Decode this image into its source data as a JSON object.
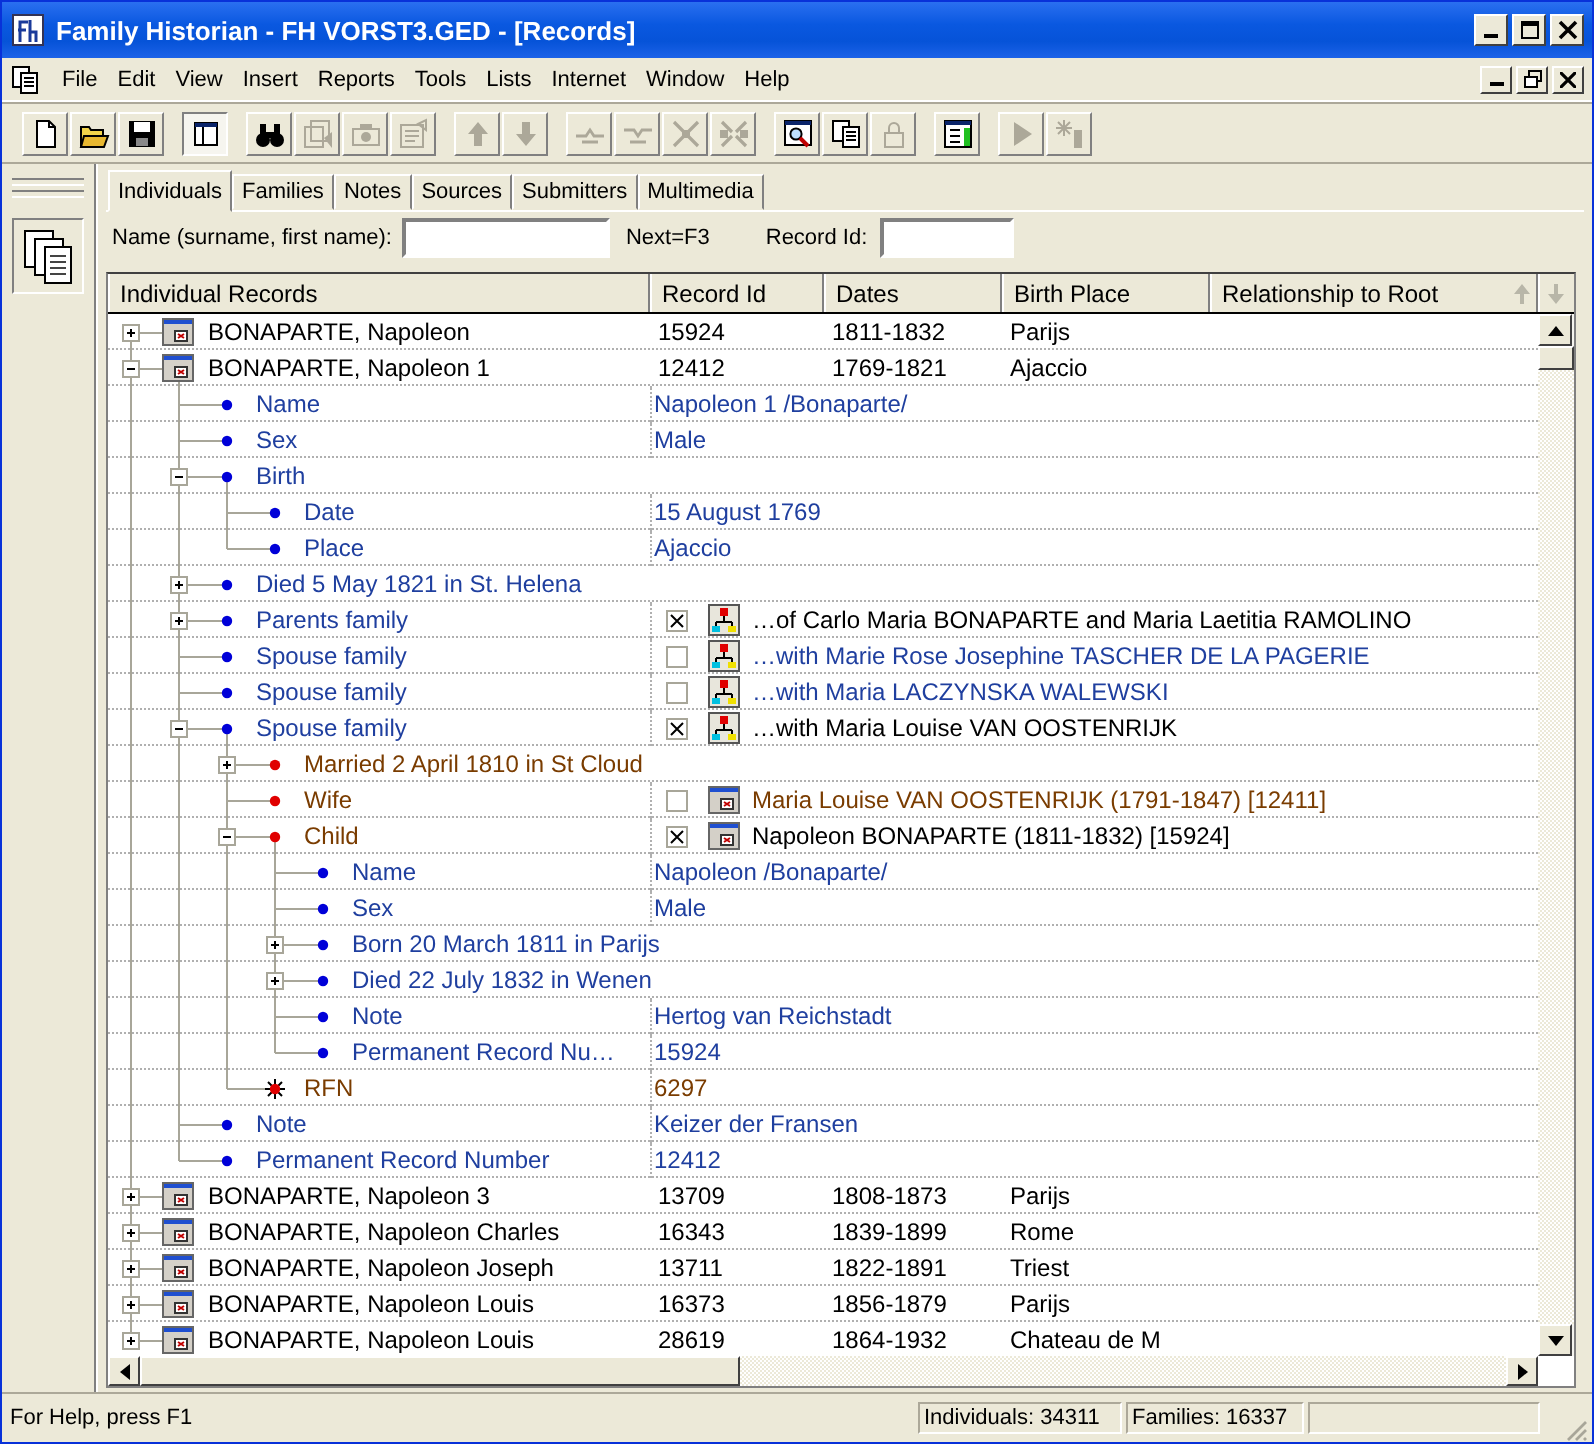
{
  "window": {
    "title": "Family Historian - FH VORST3.GED - [Records]"
  },
  "menu": [
    "File",
    "Edit",
    "View",
    "Insert",
    "Reports",
    "Tools",
    "Lists",
    "Internet",
    "Window",
    "Help"
  ],
  "toolbar": [
    [
      {
        "kind": "new",
        "disabled": false,
        "pressed": false
      },
      {
        "kind": "open",
        "disabled": false,
        "pressed": false
      },
      {
        "kind": "save",
        "disabled": false,
        "pressed": false
      }
    ],
    [
      {
        "kind": "layout",
        "disabled": false,
        "pressed": true
      }
    ],
    [
      {
        "kind": "find",
        "disabled": false,
        "pressed": false
      },
      {
        "kind": "records",
        "disabled": true,
        "pressed": false
      },
      {
        "kind": "camera",
        "disabled": true,
        "pressed": false
      },
      {
        "kind": "properties",
        "disabled": true,
        "pressed": false
      }
    ],
    [
      {
        "kind": "up",
        "disabled": true,
        "pressed": false
      },
      {
        "kind": "down",
        "disabled": true,
        "pressed": false
      }
    ],
    [
      {
        "kind": "branch_in",
        "disabled": true,
        "pressed": false
      },
      {
        "kind": "branch_out",
        "disabled": true,
        "pressed": false
      },
      {
        "kind": "expand_all",
        "disabled": true,
        "pressed": false
      },
      {
        "kind": "collapse_all",
        "disabled": true,
        "pressed": false
      }
    ],
    [
      {
        "kind": "preview",
        "disabled": false,
        "pressed": false
      },
      {
        "kind": "copy",
        "disabled": false,
        "pressed": false
      },
      {
        "kind": "lock",
        "disabled": true,
        "pressed": false
      }
    ],
    [
      {
        "kind": "app",
        "disabled": false,
        "pressed": false
      }
    ],
    [
      {
        "kind": "play",
        "disabled": true,
        "pressed": false
      },
      {
        "kind": "star",
        "disabled": true,
        "pressed": false
      }
    ]
  ],
  "tabs": [
    {
      "label": "Individuals",
      "selected": true
    },
    {
      "label": "Families",
      "selected": false
    },
    {
      "label": "Notes",
      "selected": false
    },
    {
      "label": "Sources",
      "selected": false
    },
    {
      "label": "Submitters",
      "selected": false
    },
    {
      "label": "Multimedia",
      "selected": false
    }
  ],
  "search": {
    "name_label": "Name (surname, first name):",
    "hint": "Next=F3",
    "id_label": "Record Id:"
  },
  "columns": [
    "Individual Records",
    "Record Id",
    "Dates",
    "Birth Place",
    "Relationship to Root"
  ],
  "records": [
    {
      "name": "BONAPARTE, Napoleon",
      "id": "15924",
      "dates": "1811-1832",
      "place": "Parijs",
      "expanded": false
    },
    {
      "name": "BONAPARTE, Napoleon 1",
      "id": "12412",
      "dates": "1769-1821",
      "place": "Ajaccio",
      "expanded": true,
      "children": [
        {
          "kind": "fact",
          "label": "Name",
          "value": "Napoleon 1 /Bonaparte/"
        },
        {
          "kind": "fact",
          "label": "Sex",
          "value": "Male"
        },
        {
          "kind": "fact",
          "label": "Birth",
          "expanded": true,
          "children": [
            {
              "kind": "fact",
              "label": "Date",
              "value": "15 August 1769"
            },
            {
              "kind": "fact",
              "label": "Place",
              "value": "Ajaccio"
            }
          ]
        },
        {
          "kind": "fact",
          "label": "Died 5 May 1821 in St. Helena",
          "expanded": false
        },
        {
          "kind": "fact",
          "label": "Parents family",
          "expanded": false,
          "link": {
            "kind": "family",
            "checked": true,
            "text": "…of Carlo Maria BONAPARTE and Maria Laetitia RAMOLINO"
          }
        },
        {
          "kind": "fact",
          "label": "Spouse family",
          "link": {
            "kind": "family",
            "checked": false,
            "text": "…with Marie Rose Josephine TASCHER DE LA PAGERIE"
          }
        },
        {
          "kind": "fact",
          "label": "Spouse family",
          "link": {
            "kind": "family",
            "checked": false,
            "text": "…with Maria LACZYNSKA WALEWSKI"
          }
        },
        {
          "kind": "fact",
          "label": "Spouse family",
          "expanded": true,
          "link": {
            "kind": "family",
            "checked": true,
            "text": "…with Maria Louise VAN OOSTENRIJK"
          },
          "children": [
            {
              "kind": "family_fact",
              "label": "Married 2 April 1810 in St Cloud",
              "expanded": false
            },
            {
              "kind": "family_fact",
              "label": "Wife",
              "link": {
                "kind": "record",
                "checked": false,
                "text": "Maria Louise VAN OOSTENRIJK (1791-1847) [12411]"
              }
            },
            {
              "kind": "family_fact",
              "label": "Child",
              "expanded": true,
              "link": {
                "kind": "record",
                "checked": true,
                "text": "Napoleon BONAPARTE (1811-1832) [15924]"
              },
              "children": [
                {
                  "kind": "fact",
                  "label": "Name",
                  "value": "Napoleon /Bonaparte/"
                },
                {
                  "kind": "fact",
                  "label": "Sex",
                  "value": "Male"
                },
                {
                  "kind": "fact",
                  "label": "Born 20 March 1811 in Parijs",
                  "expanded": false
                },
                {
                  "kind": "fact",
                  "label": "Died 22 July 1832 in Wenen",
                  "expanded": false
                },
                {
                  "kind": "fact",
                  "label": "Note",
                  "value": "Hertog van Reichstadt"
                },
                {
                  "kind": "fact",
                  "label": "Permanent Record Nu…",
                  "value": "15924"
                }
              ]
            },
            {
              "kind": "flag",
              "label": "RFN",
              "value": "6297"
            }
          ]
        },
        {
          "kind": "fact",
          "label": "Note",
          "value": "Keizer der Fransen"
        },
        {
          "kind": "fact",
          "label": "Permanent Record Number",
          "value": "12412"
        }
      ]
    },
    {
      "name": "BONAPARTE, Napoleon 3",
      "id": "13709",
      "dates": "1808-1873",
      "place": "Parijs",
      "expanded": false
    },
    {
      "name": "BONAPARTE, Napoleon Charles",
      "id": "16343",
      "dates": "1839-1899",
      "place": "Rome",
      "expanded": false
    },
    {
      "name": "BONAPARTE, Napoleon Joseph",
      "id": "13711",
      "dates": "1822-1891",
      "place": "Triest",
      "expanded": false
    },
    {
      "name": "BONAPARTE, Napoleon Louis",
      "id": "16373",
      "dates": "1856-1879",
      "place": "Parijs",
      "expanded": false
    },
    {
      "name": "BONAPARTE, Napoleon Louis",
      "id": "28619",
      "dates": "1864-1932",
      "place": "Chateau de M",
      "expanded": false
    }
  ],
  "status": {
    "help": "For Help, press F1",
    "individuals": "Individuals: 34311",
    "families": "Families: 16337"
  }
}
